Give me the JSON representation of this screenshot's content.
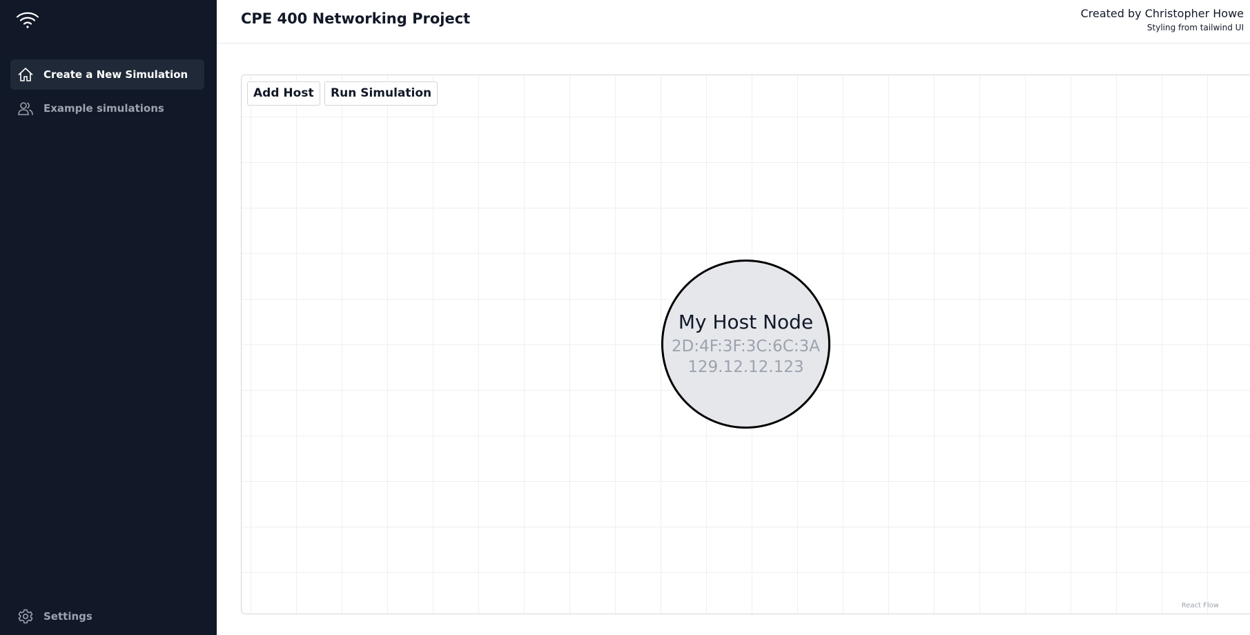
{
  "sidebar": {
    "logo_icon": "wifi-icon",
    "items": [
      {
        "label": "Create a New Simulation",
        "icon": "home-icon",
        "active": true
      },
      {
        "label": "Example simulations",
        "icon": "users-icon",
        "active": false
      }
    ],
    "settings": {
      "label": "Settings",
      "icon": "gear-icon"
    }
  },
  "header": {
    "title": "CPE 400 Networking Project",
    "credit": "Created by Christopher Howe",
    "credit_sub": "Styling from tailwind UI"
  },
  "toolbar": {
    "add_host_label": "Add Host",
    "run_simulation_label": "Run Simulation"
  },
  "flow": {
    "nodes": [
      {
        "name": "My Host Node",
        "mac": "2D:4F:3F:3C:6C:3A",
        "ip": "129.12.12.123"
      }
    ],
    "attribution": "React Flow"
  },
  "colors": {
    "sidebar_bg": "#111827",
    "active_item_bg": "#1f2937",
    "node_fill": "#e5e7eb",
    "node_border": "#000000",
    "muted_text": "#9ca3af"
  }
}
